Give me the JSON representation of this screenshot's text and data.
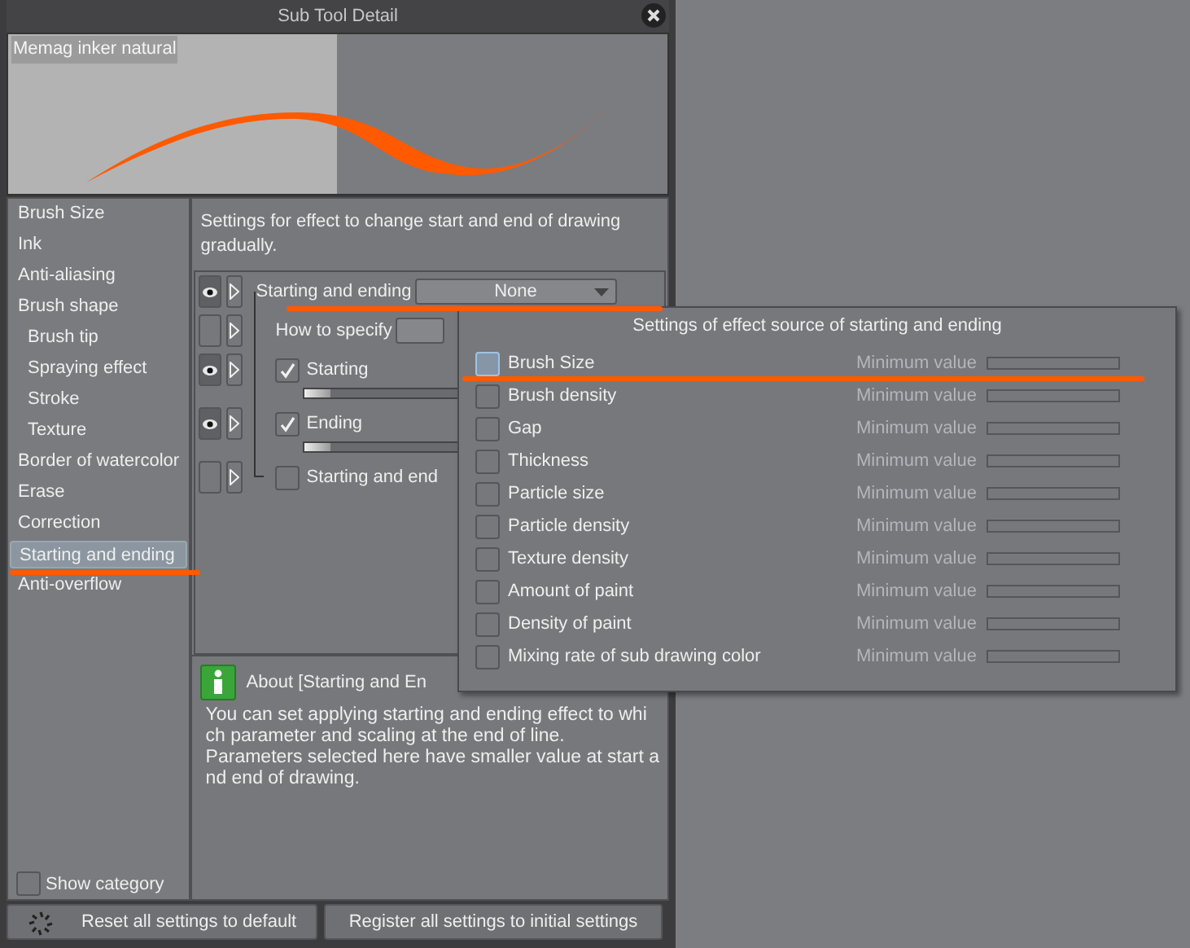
{
  "window": {
    "title": "Sub Tool Detail"
  },
  "preview": {
    "tool_name": "Memag inker natural"
  },
  "categories": [
    {
      "label": "Brush Size",
      "selected": false
    },
    {
      "label": "Ink",
      "selected": false
    },
    {
      "label": "Anti-aliasing",
      "selected": false
    },
    {
      "label": "Brush shape",
      "selected": false,
      "children": [
        {
          "label": "Brush tip",
          "selected": false
        },
        {
          "label": "Spraying effect",
          "selected": false
        },
        {
          "label": "Stroke",
          "selected": false
        },
        {
          "label": "Texture",
          "selected": false
        }
      ]
    },
    {
      "label": "Border of watercolor",
      "selected": false
    },
    {
      "label": "Erase",
      "selected": false
    },
    {
      "label": "Correction",
      "selected": false
    },
    {
      "label": "Starting and ending",
      "selected": true
    },
    {
      "label": "Anti-overflow",
      "selected": false
    }
  ],
  "description": "Settings for effect to change start and end of drawing gradually.",
  "settings": [
    {
      "kind": "dropdown",
      "label": "Starting and ending",
      "value": "None",
      "visible": true
    },
    {
      "kind": "dropdown",
      "label": "How to specify",
      "visible": false
    },
    {
      "kind": "check_slider",
      "label": "Starting",
      "checked": true,
      "level": 0.12,
      "visible": true
    },
    {
      "kind": "check_slider",
      "label": "Ending",
      "checked": true,
      "level": 0.12,
      "visible": true
    },
    {
      "kind": "check",
      "label": "Starting and end",
      "checked": false,
      "visible": false
    }
  ],
  "info": {
    "title": "About [Starting and En",
    "lines": [
      "You can set applying starting and ending effect to whi",
      "ch parameter and scaling at the end of line.",
      "Parameters selected here have smaller value at start a",
      "nd end of drawing."
    ]
  },
  "show_category": {
    "label": "Show category",
    "checked": false
  },
  "buttons": [
    {
      "kind": "reset",
      "label": "Reset all settings to default"
    },
    {
      "kind": "register",
      "label": "Register all settings to initial settings"
    }
  ],
  "popup": {
    "title": "Settings of effect source of starting and ending",
    "rows": [
      {
        "label": "Brush Size",
        "checked": false,
        "focused": true,
        "min_label": "Minimum value",
        "disabled": true
      },
      {
        "label": "Brush density",
        "checked": false,
        "focused": false,
        "min_label": "Minimum value",
        "disabled": true
      },
      {
        "label": "Gap",
        "checked": false,
        "focused": false,
        "min_label": "Minimum value",
        "disabled": true
      },
      {
        "label": "Thickness",
        "checked": false,
        "focused": false,
        "min_label": "Minimum value",
        "disabled": true
      },
      {
        "label": "Particle size",
        "checked": false,
        "focused": false,
        "min_label": "Minimum value",
        "disabled": true
      },
      {
        "label": "Particle density",
        "checked": false,
        "focused": false,
        "min_label": "Minimum value",
        "disabled": true
      },
      {
        "label": "Texture density",
        "checked": false,
        "focused": false,
        "min_label": "Minimum value",
        "disabled": true
      },
      {
        "label": "Amount of paint",
        "checked": false,
        "focused": false,
        "min_label": "Minimum value",
        "disabled": true
      },
      {
        "label": "Density of paint",
        "checked": false,
        "focused": false,
        "min_label": "Minimum value",
        "disabled": true
      },
      {
        "label": "Mixing rate of sub drawing color",
        "checked": false,
        "focused": false,
        "min_label": "Minimum value",
        "disabled": true
      }
    ]
  }
}
